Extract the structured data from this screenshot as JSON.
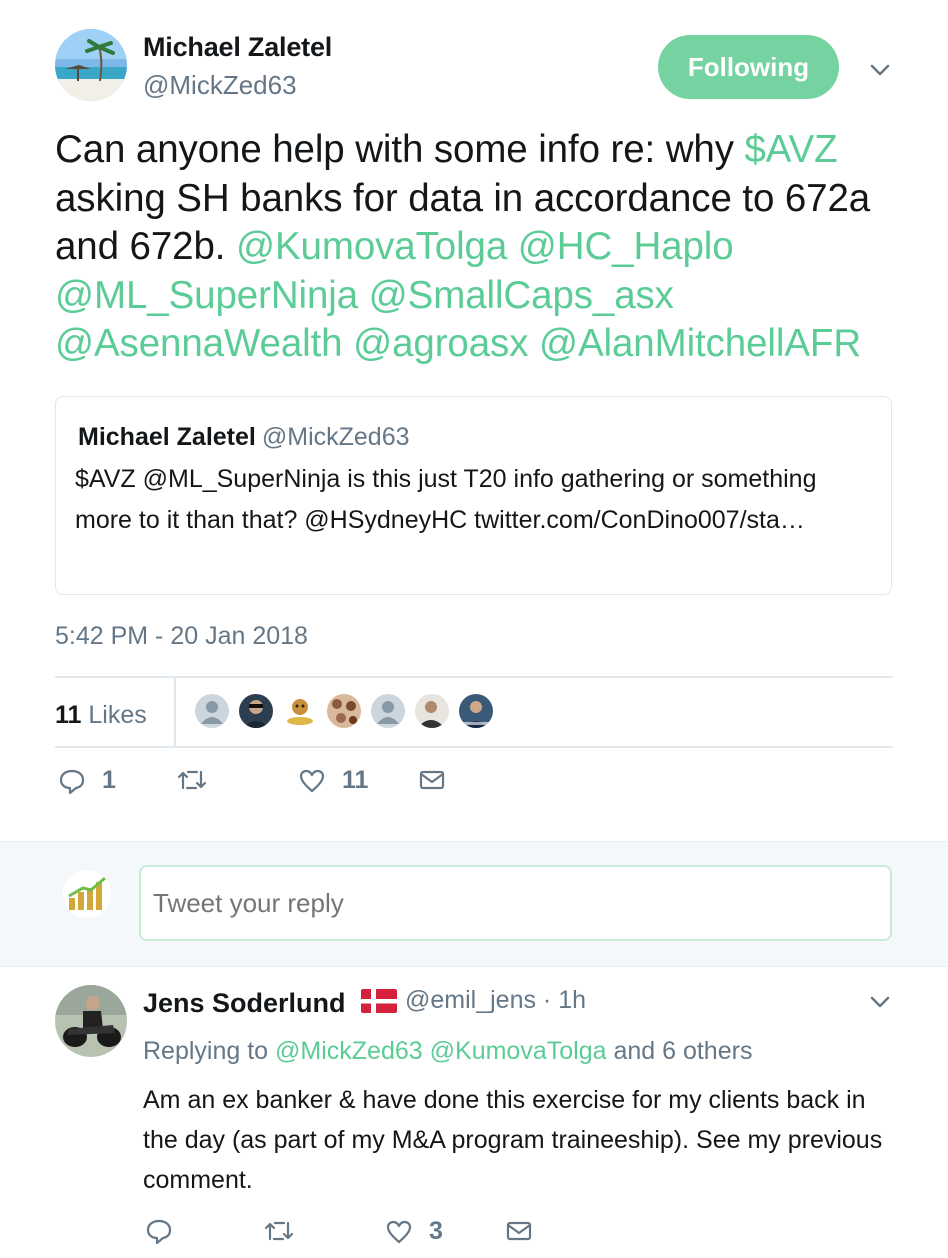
{
  "tweet": {
    "author_name": "Michael Zaletel",
    "author_handle": "@MickZed63",
    "follow_label": "Following",
    "text_parts": [
      {
        "t": "Can anyone help with some info re: why ",
        "link": false
      },
      {
        "t": "$AVZ",
        "link": true
      },
      {
        "t": " asking SH banks for data in accordance to 672a and 672b. ",
        "link": false
      },
      {
        "t": "@KumovaTolga",
        "link": true
      },
      {
        "t": " ",
        "link": false
      },
      {
        "t": "@HC_Haplo",
        "link": true
      },
      {
        "t": " ",
        "link": false
      },
      {
        "t": "@ML_SuperNinja",
        "link": true
      },
      {
        "t": " ",
        "link": false
      },
      {
        "t": "@SmallCaps_asx",
        "link": true
      },
      {
        "t": " ",
        "link": false
      },
      {
        "t": "@AsennaWealth",
        "link": true
      },
      {
        "t": " ",
        "link": false
      },
      {
        "t": "@agroasx",
        "link": true
      },
      {
        "t": " ",
        "link": false
      },
      {
        "t": "@AlanMitchellAFR",
        "link": true
      }
    ],
    "quote": {
      "name": "Michael Zaletel",
      "handle": "@MickZed63",
      "text": "$AVZ @ML_SuperNinja is this just T20 info gathering or something more to it than that? @HSydneyHC twitter.com/ConDino007/sta…"
    },
    "timestamp": "5:42 PM - 20 Jan 2018",
    "likes_count": "11",
    "likes_label": "Likes",
    "actions": {
      "reply_count": "1",
      "retweet_count": "",
      "like_count": "11"
    }
  },
  "reply_box": {
    "placeholder": "Tweet your reply"
  },
  "reply": {
    "name": "Jens Soderlund",
    "handle_time": "@emil_jens · 1h",
    "replying_prefix": "Replying to",
    "replying_user1": "@MickZed63",
    "replying_user2": "@KumovaTolga",
    "replying_suffix": "and 6 others",
    "text": "Am an ex banker & have done this exercise for my clients back in the day (as part of my M&A program traineeship). See my previous comment.",
    "like_count": "3"
  },
  "colors": {
    "accent": "#5ccc97",
    "follow_button": "#74d3a1",
    "secondary_text": "#657786",
    "border": "#e1e8ed"
  }
}
